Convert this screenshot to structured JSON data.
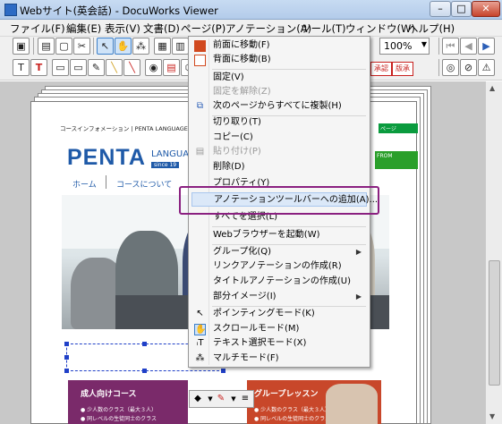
{
  "window": {
    "title": "Webサイト(英会話) - DocuWorks Viewer",
    "min": "–",
    "max": "□",
    "close": "✕"
  },
  "menubar": [
    "ファイル(F)",
    "編集(E)",
    "表示(V)",
    "文書(D)",
    "ページ(P)",
    "アノテーション(A)",
    "ツール(T)",
    "ウィンドウ(W)",
    "ヘルプ(H)"
  ],
  "toolbar": {
    "zoom": "100%"
  },
  "document": {
    "course_info": "コースインフォメーション | PENTA LANGUAGE SCHOOL",
    "logo": "PENTA",
    "lang_school": "LANGUAGE S",
    "since": "since 19",
    "nav_home": "ホーム",
    "nav_course": "コースについて",
    "tag_top": "ページ",
    "tag_green": "FROM",
    "banner_adult": {
      "title": "成人向けコース",
      "line1": "● 少人数のクラス（最大３人）",
      "line2": "● 同レベルの生徒同士のクラス"
    },
    "banner_group": {
      "title": "グループレッスン",
      "line1": "● 少人数のクラス（最大３人）",
      "line2": "● 同レベルの生徒同士のクラス"
    }
  },
  "context_menu": {
    "items": [
      {
        "label": "前面に移動(F)",
        "icon": "bring-front-icon",
        "disabled": false
      },
      {
        "label": "背面に移動(B)",
        "icon": "send-back-icon",
        "disabled": false
      },
      {
        "sep": true
      },
      {
        "label": "固定(V)",
        "disabled": false
      },
      {
        "label": "固定を解除(Z)",
        "disabled": true
      },
      {
        "label": "次のページからすべてに複製(H)",
        "icon": "duplicate-icon",
        "disabled": false
      },
      {
        "sep": true
      },
      {
        "label": "切り取り(T)",
        "disabled": false
      },
      {
        "label": "コピー(C)",
        "disabled": false
      },
      {
        "label": "貼り付け(P)",
        "icon": "paste-icon",
        "disabled": true
      },
      {
        "label": "削除(D)",
        "disabled": false
      },
      {
        "label": "プロパティ(Y)",
        "disabled": false
      },
      {
        "sep": true
      },
      {
        "label": "アノテーションツールバーへの追加(A)...",
        "disabled": false,
        "highlight": true
      },
      {
        "label": "すべてを選択(L)",
        "disabled": false
      },
      {
        "sep": true
      },
      {
        "label": "Webブラウザーを起動(W)",
        "disabled": false
      },
      {
        "sep": true
      },
      {
        "label": "グループ化(Q)",
        "disabled": false,
        "submenu": true
      },
      {
        "label": "リンクアノテーションの作成(R)",
        "disabled": false
      },
      {
        "label": "タイトルアノテーションの作成(U)",
        "disabled": false
      },
      {
        "label": "部分イメージ(I)",
        "disabled": false,
        "submenu": true
      },
      {
        "sep": true
      },
      {
        "label": "ポインティングモード(K)",
        "icon": "pointer-icon",
        "disabled": false
      },
      {
        "label": "スクロールモード(M)",
        "icon": "hand-icon",
        "disabled": false
      },
      {
        "label": "テキスト選択モード(X)",
        "icon": "text-select-icon",
        "disabled": false
      },
      {
        "label": "マルチモード(F)",
        "icon": "multi-mode-icon",
        "disabled": false
      }
    ]
  }
}
